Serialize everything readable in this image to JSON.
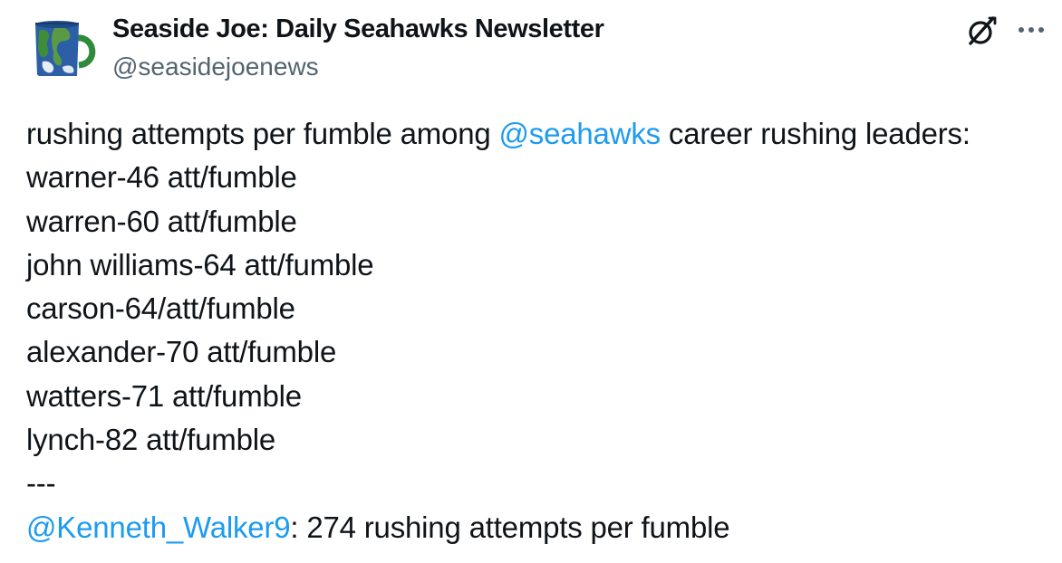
{
  "author": {
    "display_name": "Seaside Joe: Daily Seahawks Newsletter",
    "handle": "@seasidejoenews",
    "avatar_icon": "earth-mug-avatar"
  },
  "actions": {
    "grok_icon": "grok-icon",
    "more_icon": "more-horizontal-icon"
  },
  "tweet": {
    "intro_text": "rushing attempts per fumble among ",
    "intro_mention": "@seahawks",
    "intro_suffix": " career rushing leaders:",
    "lines": [
      "warner-46 att/fumble",
      "warren-60 att/fumble",
      "john williams-64 att/fumble",
      "carson-64/att/fumble",
      "alexander-70 att/fumble",
      "watters-71 att/fumble",
      "lynch-82 att/fumble"
    ],
    "separator": "---",
    "final_mention": "@Kenneth_Walker9",
    "final_text": ": 274 rushing attempts per fumble"
  },
  "colors": {
    "link": "#1d9bf0",
    "secondary_text": "#536471",
    "primary_text": "#0f1419"
  }
}
